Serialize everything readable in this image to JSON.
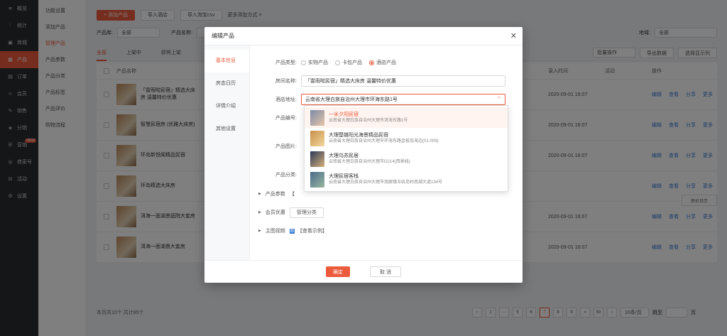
{
  "nav": {
    "items": [
      {
        "icon": "≋",
        "label": "概览",
        "active": false
      },
      {
        "icon": "⫶",
        "label": "统计",
        "active": false
      },
      {
        "icon": "▣",
        "label": "商城",
        "active": false
      },
      {
        "icon": "▦",
        "label": "产品",
        "active": true
      },
      {
        "icon": "▤",
        "label": "订单",
        "active": false
      },
      {
        "icon": "☺",
        "label": "会员",
        "active": false
      },
      {
        "icon": "✎",
        "label": "销售",
        "active": false
      },
      {
        "icon": "◈",
        "label": "分销",
        "active": false
      },
      {
        "icon": "☰",
        "label": "营销",
        "active": false,
        "badge": "NEW"
      },
      {
        "icon": "◎",
        "label": "商家号",
        "active": false
      },
      {
        "icon": "⊟",
        "label": "活动",
        "active": false
      },
      {
        "icon": "⚙",
        "label": "设置",
        "active": false
      }
    ]
  },
  "subnav": {
    "items": [
      "功能设置",
      "添加产品",
      "管理产品",
      "产品参数",
      "产品分类",
      "产品标签",
      "产品评价",
      "购物流程"
    ],
    "active_index": 2
  },
  "toolbar": {
    "add_label": "+ 添加产品",
    "import_label": "导入酒店",
    "import_csv_label": "导入淘宝csv",
    "more_label": "更多添加方式 >"
  },
  "filters": {
    "field1_label": "产品库:",
    "field1_value": "全部",
    "field2_label": "产品名称:",
    "right_label": "地域:",
    "right_value": "全部"
  },
  "tabs": {
    "items": [
      "全部",
      "上架中",
      "即将上架"
    ],
    "batch_label": "批量操作",
    "export_label": "导出数据",
    "column_label": "选择显示列"
  },
  "table": {
    "header_name": "产品名称",
    "header_time": "录入时间",
    "header_status": "活动",
    "header_ops": "操作",
    "rows": [
      {
        "name": "「雷雨啦民宿」精选大床房 温馨特价优惠",
        "time": "2020-09-01 16:07"
      },
      {
        "name": "智慧民宿房 (优雅大床房)",
        "time": "2020-09-01 16:07"
      },
      {
        "name": "环岛新悦阁精品民宿",
        "time": "2020-09-01 16:07"
      },
      {
        "name": "环岛精选大床房",
        "time": ""
      },
      {
        "name": "洱海一面湖景庭院大套房",
        "time": "2020-09-01 16:07"
      },
      {
        "name": "洱海一面湖景大套房",
        "time": "2020-09-01 16:07"
      }
    ],
    "op_edit": "编辑",
    "op_view": "查看",
    "op_share": "分享",
    "op_more": "更多"
  },
  "pager": {
    "info": "本页共10个 共计85个",
    "pages": [
      "‹",
      "1",
      "···",
      "5",
      "6",
      "7",
      "8",
      "9",
      "»",
      "50",
      "›"
    ],
    "active_page": "7",
    "per_page": "10条/页",
    "goto_label": "跳至",
    "page_unit": "页"
  },
  "float_button": "房价日历",
  "modal": {
    "title": "编辑产品",
    "side_items": [
      "基本信息",
      "房态日历",
      "详情介绍",
      "其他设置"
    ],
    "side_active": 0,
    "type_label": "产品类型:",
    "type_options": [
      {
        "label": "实物产品",
        "checked": false
      },
      {
        "label": "卡包产品",
        "checked": false
      },
      {
        "label": "酒店产品",
        "checked": true
      }
    ],
    "room_label": "房间名称:",
    "room_value": "「雷雨啦民宿」精选大床房 温馨特价优惠",
    "hotel_label": "酒店地址:",
    "hotel_value": "云南省大理白族自治州大理市环海东路1号",
    "row4_label": "产品编号:",
    "row5_label": "产品图片:",
    "row6_label": "产品分类:",
    "dropdown": [
      {
        "name": "一米夕阳民宿",
        "addr": "云南省大理白族自治州大理市洱海东路1号",
        "hover": true,
        "color1": "#7a8aa8",
        "color2": "#e6c6a8"
      },
      {
        "name": "大理楚雄阳光海景精品民宿",
        "addr": "云南省大理白族自治州大理市环海东路金梭岛海边(01-009)",
        "hover": false,
        "color1": "#c89048",
        "color2": "#f2d8a0"
      },
      {
        "name": "大理乌苏民居",
        "addr": "云南省大理白族自治州大理市G214(西景线)",
        "hover": false,
        "color1": "#2a3a58",
        "color2": "#d8b07a"
      },
      {
        "name": "大理民宿客栈",
        "addr": "云南省大理白族自治州大理市双廊镇玉矶岛村南湖大道134号",
        "hover": false,
        "color1": "#4a6a8a",
        "color2": "#9ab8a0"
      }
    ],
    "params_label": "产品参数",
    "params_hint": "【",
    "member_label": "会员优惠",
    "member_button": "管理分类",
    "gallery_label": "主图视频",
    "gallery_tag": "图",
    "gallery_link": "【查看示例】",
    "ok_label": "确定",
    "cancel_label": "取 消"
  },
  "colors": {
    "accent": "#ec5a3c",
    "nav_bg": "#2b2d31",
    "link": "#3a7bd5"
  }
}
